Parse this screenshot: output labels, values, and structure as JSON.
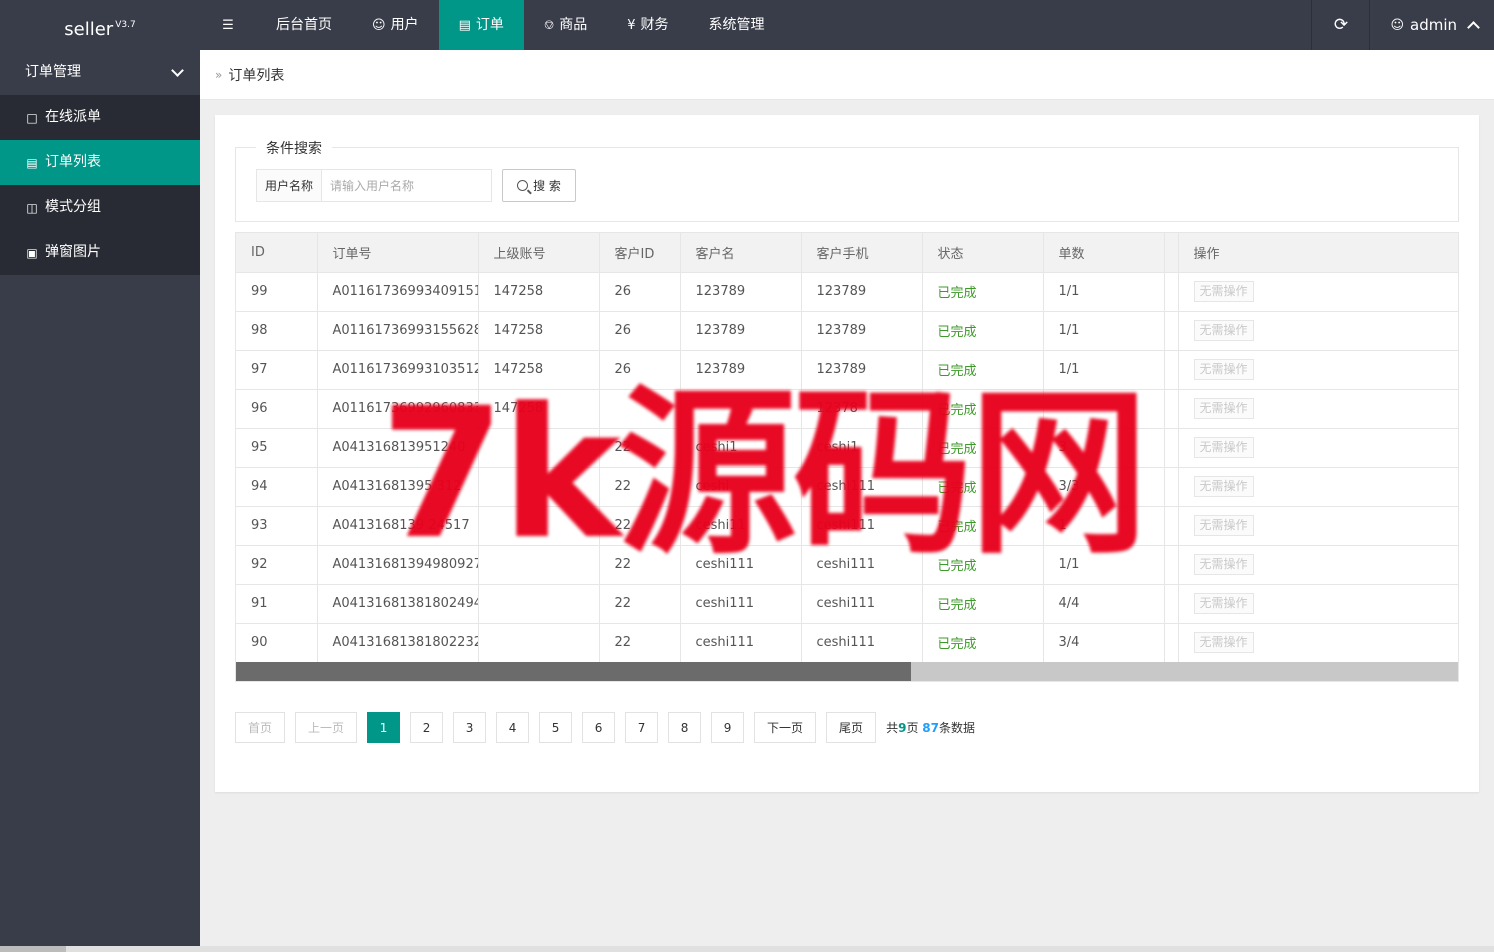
{
  "logo": {
    "name": "seller",
    "version": "V3.7"
  },
  "topnav": {
    "items": [
      {
        "label": "后台首页",
        "icon": ""
      },
      {
        "label": "用户",
        "icon": "user-icon"
      },
      {
        "label": "订单",
        "icon": "file-icon",
        "active": true
      },
      {
        "label": "商品",
        "icon": "cart-icon"
      },
      {
        "label": "财务",
        "icon": "yen-icon"
      },
      {
        "label": "系统管理",
        "icon": ""
      }
    ],
    "user": "admin"
  },
  "sidebar": {
    "group": "订单管理",
    "items": [
      {
        "label": "在线派单",
        "icon": "note-icon"
      },
      {
        "label": "订单列表",
        "icon": "list-icon",
        "active": true
      },
      {
        "label": "模式分组",
        "icon": "group-icon"
      },
      {
        "label": "弹窗图片",
        "icon": "image-icon"
      }
    ]
  },
  "breadcrumb": {
    "current": "订单列表"
  },
  "search": {
    "legend": "条件搜索",
    "label": "用户名称",
    "placeholder": "请输入用户名称",
    "value": "",
    "button": "搜 索"
  },
  "table": {
    "headers": [
      "ID",
      "订单号",
      "上级账号",
      "客户ID",
      "客户名",
      "客户手机",
      "状态",
      "单数",
      "操作"
    ],
    "rows": [
      {
        "id": "99",
        "order": "A01161736993409151",
        "parent": "147258",
        "cid": "26",
        "cname": "123789",
        "phone": "123789",
        "status": "已完成",
        "count": "1/1",
        "op": "无需操作"
      },
      {
        "id": "98",
        "order": "A01161736993155628",
        "parent": "147258",
        "cid": "26",
        "cname": "123789",
        "phone": "123789",
        "status": "已完成",
        "count": "1/1",
        "op": "无需操作"
      },
      {
        "id": "97",
        "order": "A01161736993103512",
        "parent": "147258",
        "cid": "26",
        "cname": "123789",
        "phone": "123789",
        "status": "已完成",
        "count": "1/1",
        "op": "无需操作"
      },
      {
        "id": "96",
        "order": "A01161736992960833",
        "parent": "147258",
        "cid": "",
        "cname": "",
        "phone": "12378",
        "status": "已完成",
        "count": "",
        "op": "无需操作"
      },
      {
        "id": "95",
        "order": "A041316813951240",
        "parent": "",
        "cid": "22",
        "cname": "ceshi1",
        "phone": "ceshi1",
        "status": "已完成",
        "count": "3",
        "op": "无需操作"
      },
      {
        "id": "94",
        "order": "A04131681395  312",
        "parent": "",
        "cid": "22",
        "cname": "ceshi",
        "phone": "ceshi111",
        "status": "已完成",
        "count": "3/3",
        "op": "无需操作"
      },
      {
        "id": "93",
        "order": "A0413168139  24517",
        "parent": "",
        "cid": "22",
        "cname": "ceshi11",
        "phone": "ceshi111",
        "status": "已完成",
        "count": "1",
        "op": "无需操作"
      },
      {
        "id": "92",
        "order": "A04131681394980927",
        "parent": "",
        "cid": "22",
        "cname": "ceshi111",
        "phone": "ceshi111",
        "status": "已完成",
        "count": "1/1",
        "op": "无需操作"
      },
      {
        "id": "91",
        "order": "A04131681381802494",
        "parent": "",
        "cid": "22",
        "cname": "ceshi111",
        "phone": "ceshi111",
        "status": "已完成",
        "count": "4/4",
        "op": "无需操作"
      },
      {
        "id": "90",
        "order": "A04131681381802232",
        "parent": "",
        "cid": "22",
        "cname": "ceshi111",
        "phone": "ceshi111",
        "status": "已完成",
        "count": "3/4",
        "op": "无需操作"
      }
    ]
  },
  "pager": {
    "first": "首页",
    "prev": "上一页",
    "pages": [
      "1",
      "2",
      "3",
      "4",
      "5",
      "6",
      "7",
      "8",
      "9"
    ],
    "current": "1",
    "next": "下一页",
    "last": "尾页",
    "total_prefix": "共",
    "total_pages": "9",
    "pages_suffix": "页",
    "total_count": "87",
    "count_suffix": "条数据"
  },
  "watermark": "7k源码网",
  "colors": {
    "accent": "#009688",
    "dark": "#393d49",
    "done": "#3c9a28",
    "watermark": "#e8001c"
  }
}
